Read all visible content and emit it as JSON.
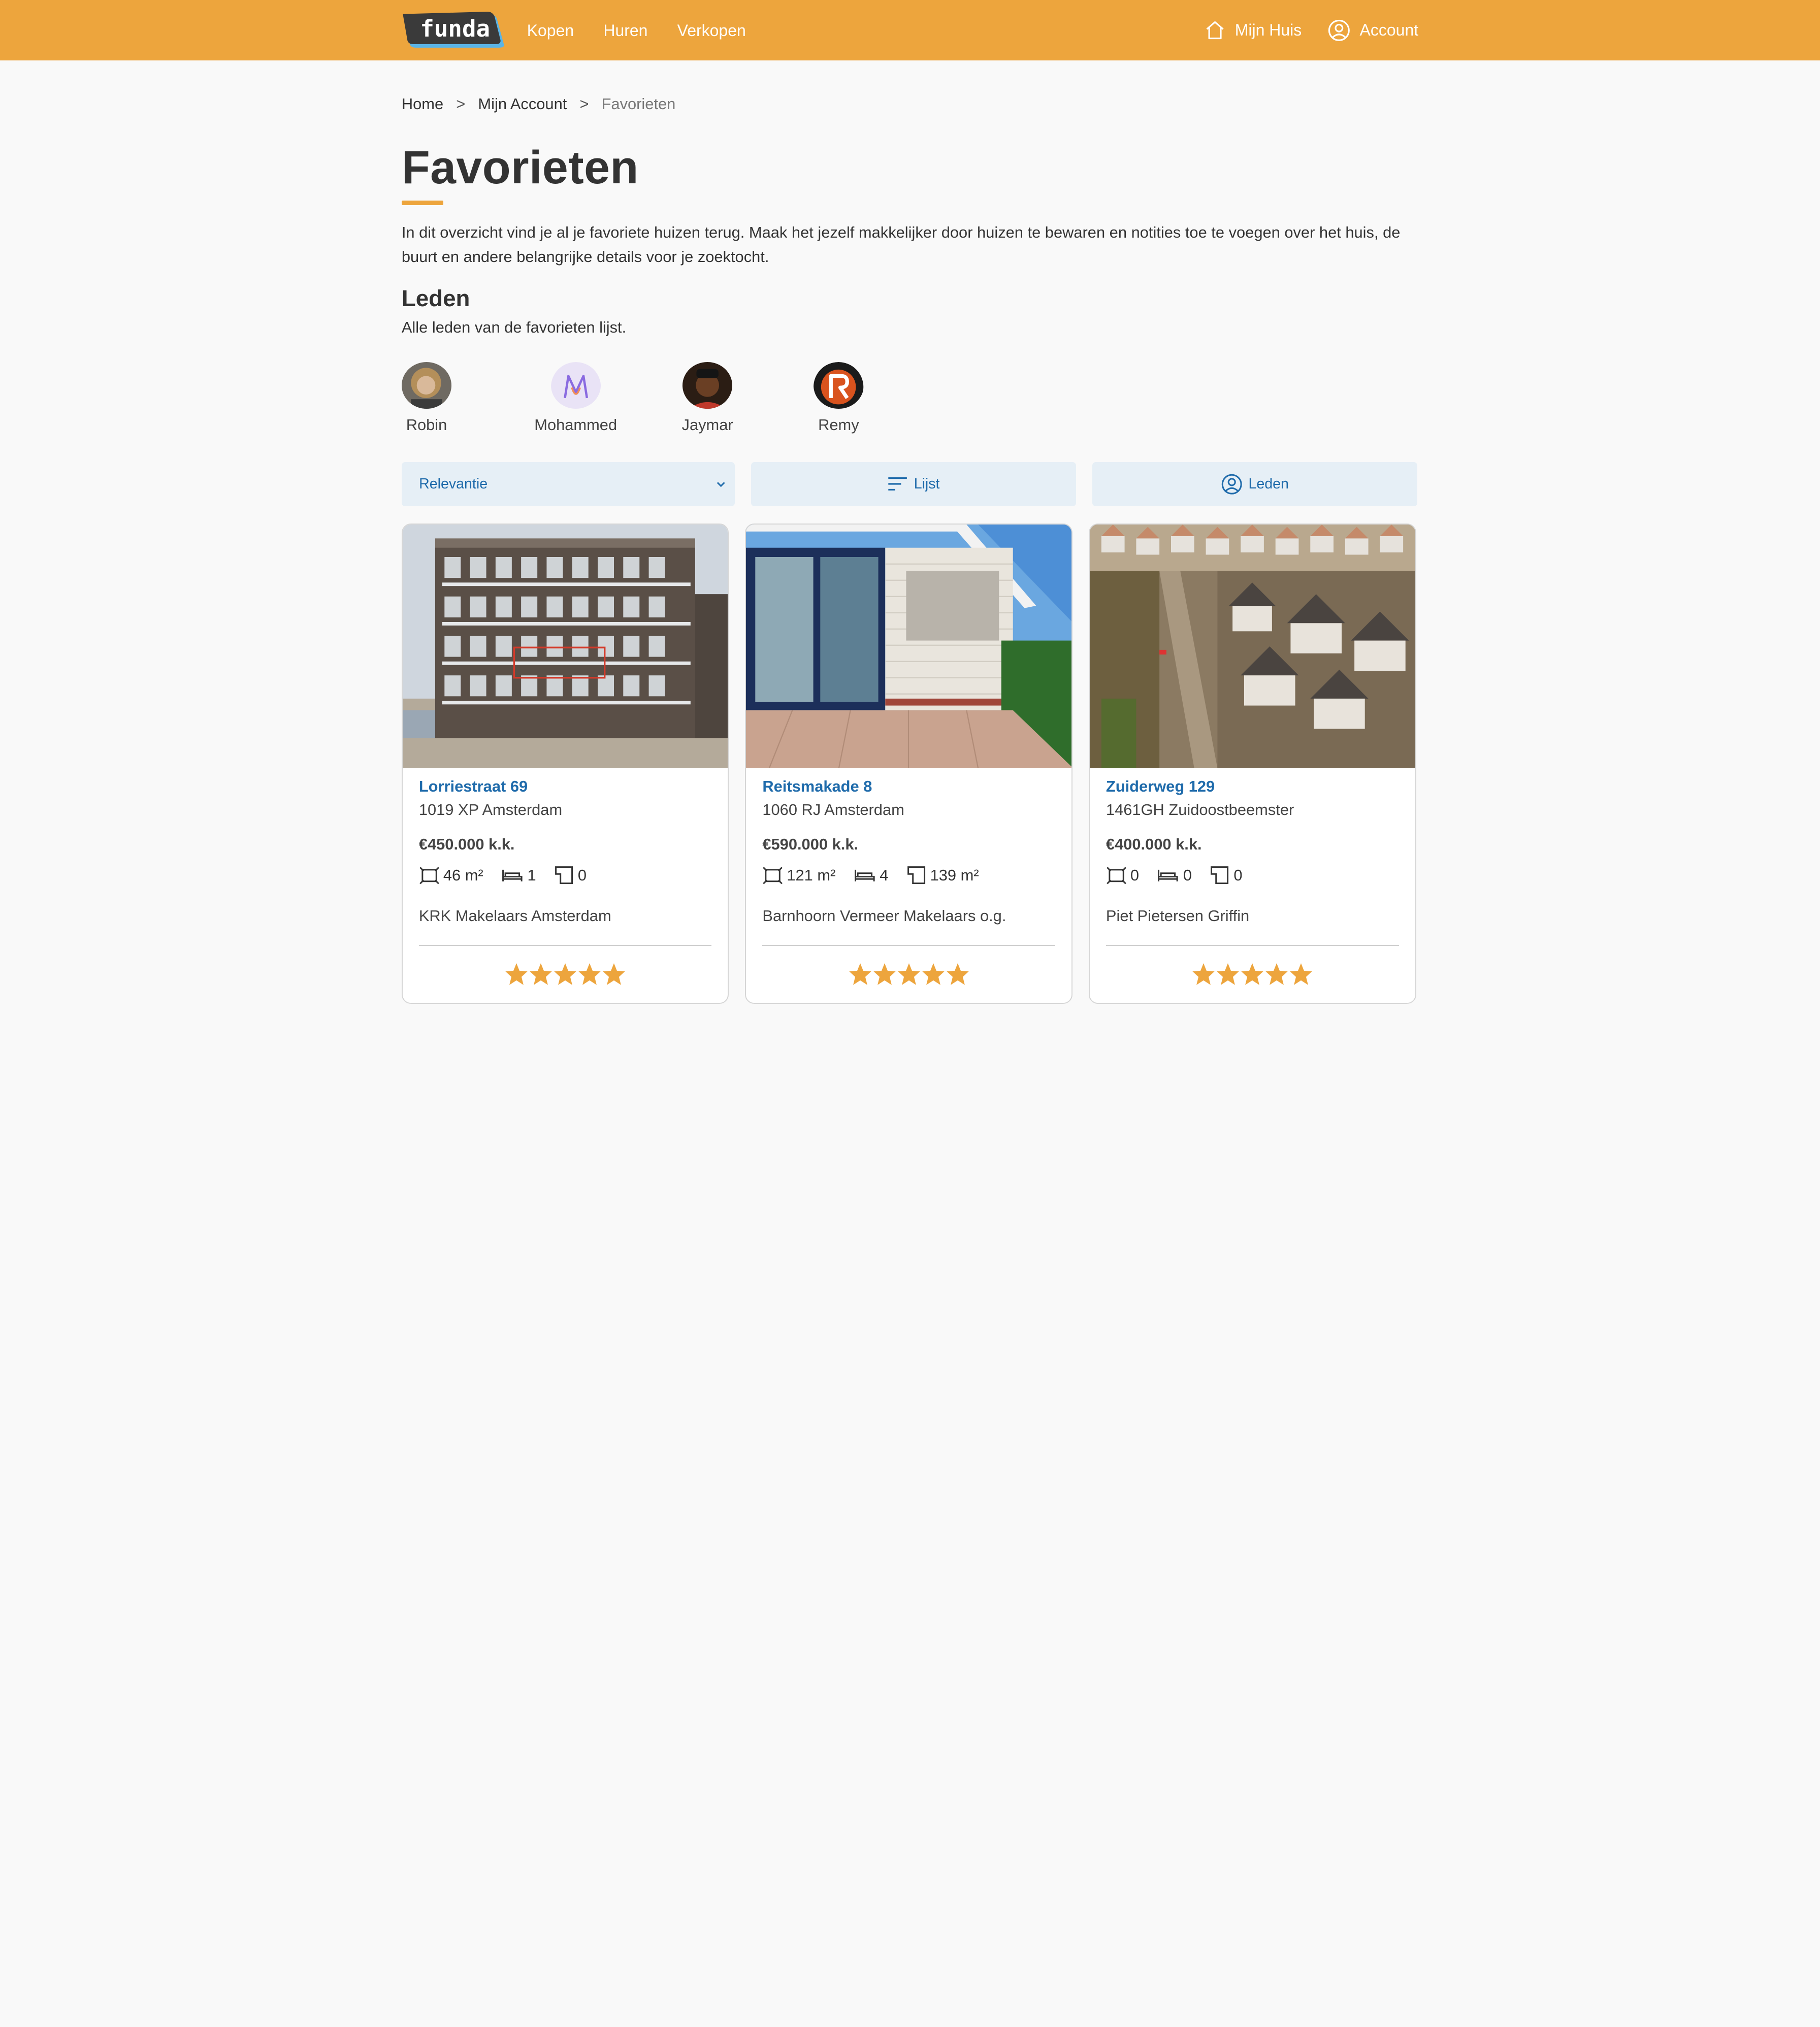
{
  "header": {
    "logo_text": "funda",
    "nav": [
      "Kopen",
      "Huren",
      "Verkopen"
    ],
    "my_home_label": "Mijn Huis",
    "account_label": "Account"
  },
  "breadcrumb": {
    "home": "Home",
    "account": "Mijn Account",
    "current": "Favorieten",
    "separator": ">"
  },
  "page": {
    "title": "Favorieten",
    "intro": "In dit overzicht vind je al je favoriete huizen terug. Maak het jezelf makkelijker door huizen te bewaren en notities toe te voegen over het huis, de buurt en andere belangrijke details voor je zoektocht.",
    "members_heading": "Leden",
    "members_sub": "Alle leden van de favorieten lijst."
  },
  "members": [
    {
      "name": "Robin"
    },
    {
      "name": "Mohammed"
    },
    {
      "name": "Jaymar"
    },
    {
      "name": "Remy"
    }
  ],
  "controls": {
    "sort_selected": "Relevantie",
    "list_label": "Lijst",
    "members_label": "Leden"
  },
  "listings": [
    {
      "street": "Lorriestraat 69",
      "postal": "1019 XP Amsterdam",
      "price": "€450.000 k.k.",
      "living_area": "46 m²",
      "bedrooms": "1",
      "plot": "0",
      "agent": "KRK Makelaars Amsterdam",
      "rating": 5
    },
    {
      "street": "Reitsmakade 8",
      "postal": "1060 RJ Amsterdam",
      "price": "€590.000 k.k.",
      "living_area": "121 m²",
      "bedrooms": "4",
      "plot": "139 m²",
      "agent": "Barnhoorn Vermeer Makelaars o.g.",
      "rating": 5
    },
    {
      "street": "Zuiderweg 129",
      "postal": "1461GH Zuidoostbeemster",
      "price": "€400.000 k.k.",
      "living_area": "0",
      "bedrooms": "0",
      "plot": "0",
      "agent": "Piet Pietersen Griffin",
      "rating": 5
    }
  ],
  "colors": {
    "brand": "#eda53d",
    "link": "#1f6bab",
    "control_bg": "#e6eff6"
  }
}
